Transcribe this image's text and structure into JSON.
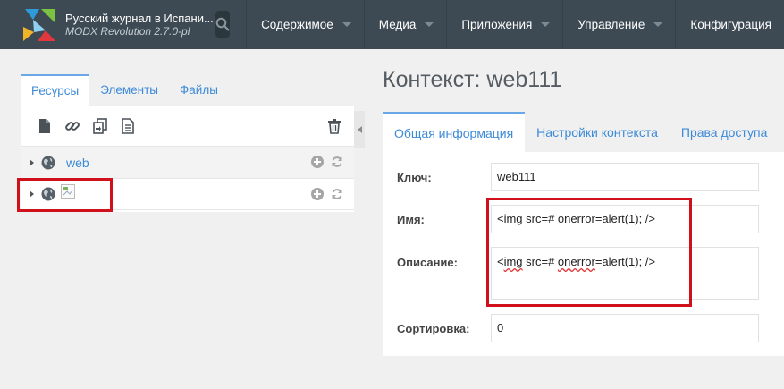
{
  "header": {
    "site_title": "Русский журнал в Испани...",
    "site_subtitle": "MODX Revolution 2.7.0-pl",
    "nav": [
      {
        "label": "Содержимое"
      },
      {
        "label": "Медиа"
      },
      {
        "label": "Приложения"
      },
      {
        "label": "Управление"
      },
      {
        "label": "Конфигурация"
      }
    ]
  },
  "left": {
    "tabs": [
      "Ресурсы",
      "Элементы",
      "Файлы"
    ],
    "tree": [
      {
        "label": "web"
      },
      {
        "label": ""
      }
    ]
  },
  "right": {
    "title": "Контекст: web111",
    "tabs": [
      "Общая информация",
      "Настройки контекста",
      "Права доступа"
    ],
    "form": {
      "key_label": "Ключ:",
      "key_value": "web111",
      "name_label": "Имя:",
      "name_value": "<img src=# onerror=alert(1); />",
      "desc_label": "Описание:",
      "desc_prefix": "<",
      "desc_word1": "img",
      "desc_mid": " src=# ",
      "desc_word2": "onerror",
      "desc_suffix": "=alert(1); />",
      "sort_label": "Сортировка:",
      "sort_value": "0"
    }
  },
  "colors": {
    "topbar": "#3e4a53",
    "accent": "#3c8ad8",
    "highlight": "#d0111b"
  }
}
